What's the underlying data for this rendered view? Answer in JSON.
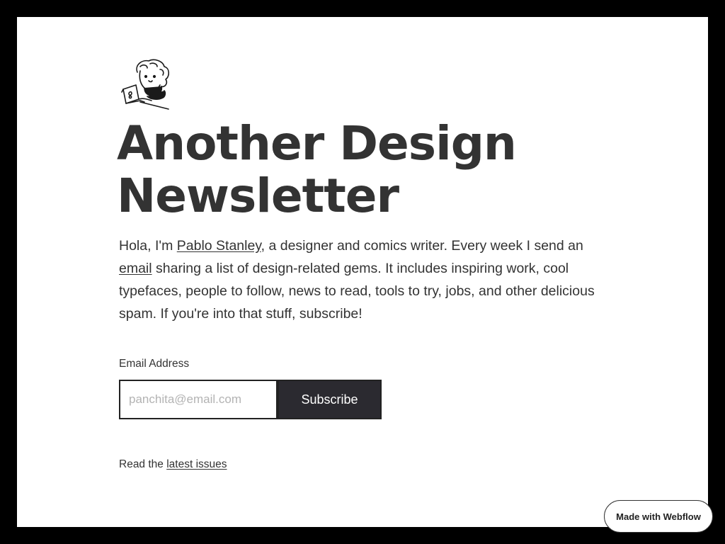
{
  "header": {
    "title": "Another Design Newsletter",
    "avatar_icon": "pablo-stanley-illustration-icon"
  },
  "intro": {
    "text_before": "Hola, I'm ",
    "author_link": "Pablo Stanley",
    "text_middle": ", a designer and comics writer. Every week I send an ",
    "email_link": "email",
    "text_after": " sharing a list of design-related gems. It includes inspiring work, cool typefaces, people to follow, news to read, tools to try, jobs, and other delicious spam. If you're into that stuff, subscribe!"
  },
  "form": {
    "label": "Email Address",
    "placeholder": "panchita@email.com",
    "value": "",
    "button_label": "Subscribe"
  },
  "footer": {
    "text_before": "Read the ",
    "link": "latest issues"
  },
  "badge": {
    "label": "Made with Webflow"
  },
  "colors": {
    "background": "#ffffff",
    "frame": "#000000",
    "text": "#333333",
    "button_bg": "#2b2a30",
    "button_text": "#ffffff",
    "placeholder": "#b3b3b3"
  }
}
